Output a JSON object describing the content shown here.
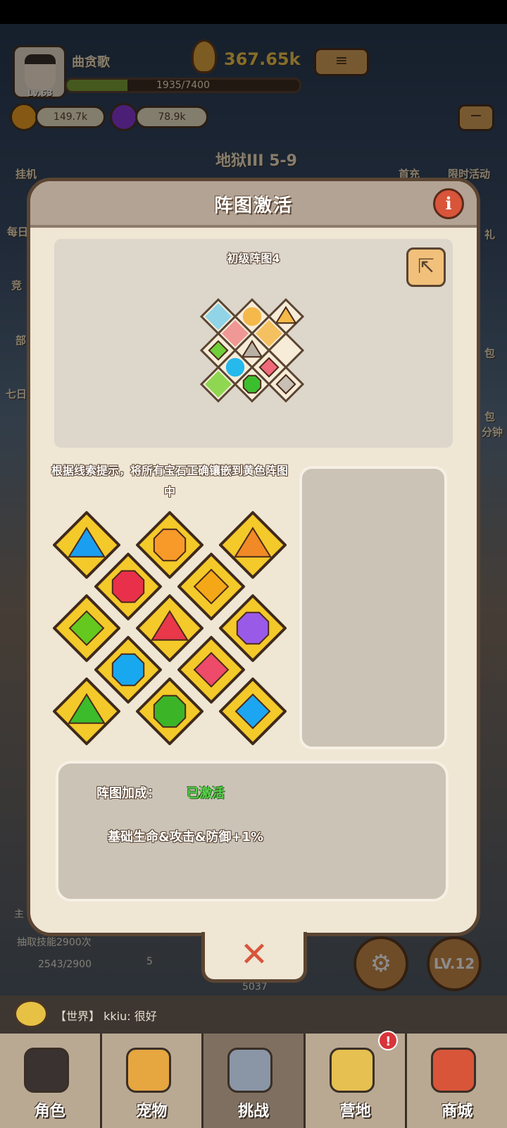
{
  "hud": {
    "player_name": "曲贪歌",
    "level": "Lv.63",
    "xp_text": "1935/7400",
    "xp_fraction": 0.26,
    "power": "367.65k",
    "gold": "149.7k",
    "gems": "78.9k",
    "stage": "地狱III 5-9",
    "idle_label": "挂机",
    "first_recharge_label": "首充",
    "limited_event_label": "限时活动",
    "side_labels": [
      "每日",
      "竞",
      "部",
      "七日"
    ],
    "right_labels": [
      "礼",
      "包",
      "包",
      "分钟"
    ]
  },
  "dialog": {
    "title": "阵图激活",
    "info_icon": "info-icon",
    "preview_title": "初级阵图4",
    "share_icon": "share-icon",
    "hint": "根据线索提示，将所有宝石正确镶嵌到黄色阵图中",
    "bonus_label": "阵图加成：",
    "bonus_status": "已激活",
    "bonus_effect": "基础生命&攻击&防御+1%",
    "close_icon": "close-icon"
  },
  "mini_grid": [
    {
      "gem": "pattern",
      "color": "#7fd0ea"
    },
    {
      "gem": "circle",
      "color": "#f4b94a"
    },
    {
      "gem": "triangle",
      "color": "#f4b94a"
    },
    {
      "gem": "pattern",
      "color": "#ef8a8a"
    },
    {
      "gem": "pattern",
      "color": "#f4b94a"
    },
    {
      "gem": "diamond",
      "color": "#6fce3a"
    },
    {
      "gem": "triangle",
      "color": "#b8b0a4"
    },
    {
      "gem": "empty",
      "color": "#f6ecd8"
    },
    {
      "gem": "circle",
      "color": "#25b9ec"
    },
    {
      "gem": "diamond",
      "color": "#ef6a7a"
    },
    {
      "gem": "pattern",
      "color": "#7ed33a"
    },
    {
      "gem": "octagon",
      "color": "#3cbf2f"
    },
    {
      "gem": "diamond",
      "color": "#c8c0b4"
    }
  ],
  "gems": [
    {
      "shape": "triangle",
      "color": "#1a9ff0"
    },
    {
      "shape": "octagon",
      "color": "#f79a2a"
    },
    {
      "shape": "triangle",
      "color": "#f18a26"
    },
    {
      "shape": "octagon",
      "color": "#e8304a"
    },
    {
      "shape": "diamond",
      "color": "#f4a818"
    },
    {
      "shape": "diamond",
      "color": "#64c81e"
    },
    {
      "shape": "triangle",
      "color": "#e8384a"
    },
    {
      "shape": "octagon",
      "color": "#9a5ae8"
    },
    {
      "shape": "octagon",
      "color": "#18a8f0"
    },
    {
      "shape": "diamond",
      "color": "#ee4a6a"
    },
    {
      "shape": "triangle",
      "color": "#3cbc2a"
    },
    {
      "shape": "octagon",
      "color": "#3cb428"
    },
    {
      "shape": "diamond",
      "color": "#1ca6f2"
    }
  ],
  "bottom": {
    "chat_channel": "【世界】",
    "chat_message": "kkiu: 很好",
    "skill_draw_text": "抽取技能2900次",
    "skill_progress": "2543/2900",
    "skill_count": "5",
    "level_button": "LV.12",
    "side_tab": "主",
    "misc_value": "5037"
  },
  "nav": [
    {
      "label": "角色",
      "icon": "character-icon",
      "color": "#3a3230"
    },
    {
      "label": "宠物",
      "icon": "pet-icon",
      "color": "#e6a640"
    },
    {
      "label": "挑战",
      "icon": "sword-icon",
      "color": "#8a96a6"
    },
    {
      "label": "营地",
      "icon": "camp-icon",
      "color": "#e6c050",
      "badge": "!"
    },
    {
      "label": "商城",
      "icon": "shop-icon",
      "color": "#d8553a"
    }
  ]
}
